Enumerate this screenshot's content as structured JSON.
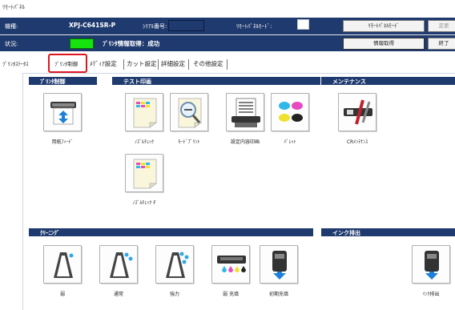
{
  "window": {
    "title": "ﾘﾓｰﾄﾊﾟﾈﾙ"
  },
  "header": {
    "model_label": "機種:",
    "model_value": "XPJ-C641SR-P",
    "serial_label": "ｼﾘｱﾙ番号:",
    "remote_panel_mode_label": "ﾘﾓｰﾄﾊﾟﾈﾙﾓｰﾄﾞ:",
    "status_label": "状況:",
    "status_value": "ﾌﾟﾘﾝﾀ情報取得：成功",
    "remote_panel_mode_button": "ﾘﾓｰﾄﾊﾟﾈﾙﾓｰﾄﾞ",
    "change_button": "変更",
    "info_get_button": "情報取得",
    "end_button": "終了",
    "status_color": "#16e30e",
    "header_color": "#1f3a6e"
  },
  "tabs": [
    {
      "label": "ﾌﾟﾘﾝﾀｽﾃｰﾀｽ"
    },
    {
      "label": "ﾌﾟﾘﾝﾀ制御"
    },
    {
      "label": "ﾒﾃﾞｨｱ設定"
    },
    {
      "label": "カット設定"
    },
    {
      "label": "詳細設定"
    },
    {
      "label": "その他設定"
    }
  ],
  "sections": {
    "printer_control": "ﾌﾟﾘﾝﾀ制御",
    "test_print": "テスト印画",
    "maintenance": "メンテナンス",
    "cleaning": "ｸﾘｰﾆﾝｸﾞ",
    "ink_discharge": "インク排出"
  },
  "buttons": {
    "paper_feed": "用紙ﾌｨｰﾄﾞ",
    "nozzle_check": "ﾉｽﾞﾙﾁｪｯｸ",
    "mode_print": "ﾓｰﾄﾞﾌﾟﾘﾝﾄ",
    "settings_print": "設定内容印画",
    "palette": "ﾊﾟﾚｯﾄ",
    "cr_maintenance": "CRﾒﾝﾃﾅﾝｽ",
    "nozzle_check_f": "ﾉｽﾞﾙﾁｪｯｸ F",
    "clean_weak": "弱",
    "clean_normal": "通常",
    "clean_strong": "強力",
    "clean_weak_fill": "弱 充填",
    "initial_fill": "初期充填",
    "ink_discharge": "ｲﾝｸ排出"
  }
}
